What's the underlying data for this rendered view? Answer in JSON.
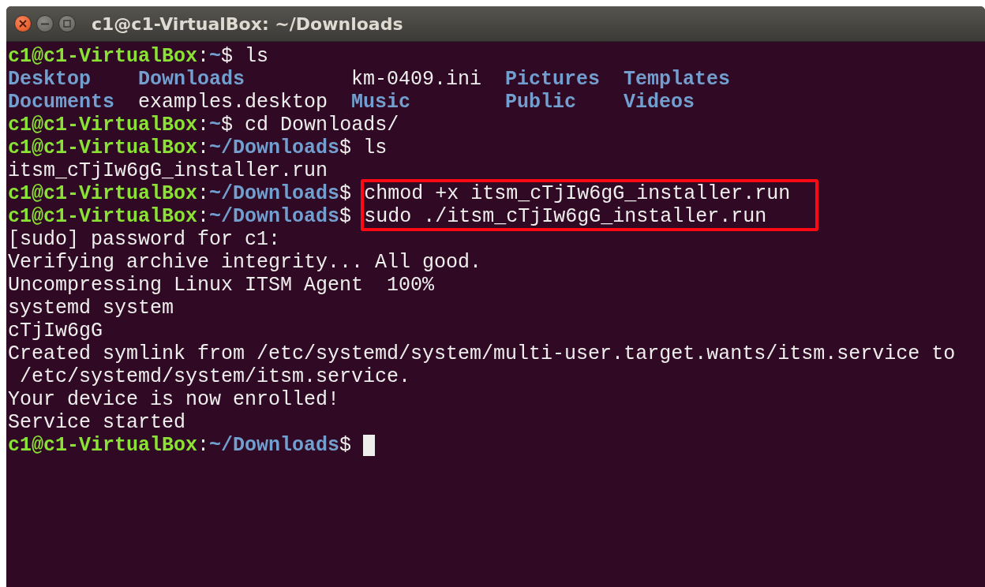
{
  "window": {
    "title": "c1@c1-VirtualBox: ~/Downloads"
  },
  "terminal": {
    "lines": [
      {
        "kind": "prompt",
        "user": "c1@c1-VirtualBox",
        "separator": ":",
        "path": "~",
        "symbol": "$",
        "command": "ls"
      },
      {
        "kind": "listing",
        "items": [
          {
            "name": "Desktop",
            "kind": "dir"
          },
          {
            "name": "Downloads",
            "kind": "dir"
          },
          {
            "name": "km-0409.ini",
            "kind": "file"
          },
          {
            "name": "Pictures",
            "kind": "dir"
          },
          {
            "name": "Templates",
            "kind": "dir"
          },
          {
            "name": "Documents",
            "kind": "dir"
          },
          {
            "name": "examples.desktop",
            "kind": "file"
          },
          {
            "name": "Music",
            "kind": "dir"
          },
          {
            "name": "Public",
            "kind": "dir"
          },
          {
            "name": "Videos",
            "kind": "dir"
          }
        ]
      },
      {
        "kind": "prompt",
        "user": "c1@c1-VirtualBox",
        "separator": ":",
        "path": "~",
        "symbol": "$",
        "command": "cd Downloads/"
      },
      {
        "kind": "prompt",
        "user": "c1@c1-VirtualBox",
        "separator": ":",
        "path": "~/Downloads",
        "symbol": "$",
        "command": "ls"
      },
      {
        "kind": "output",
        "text": "itsm_cTjIw6gG_installer.run"
      },
      {
        "kind": "highlight",
        "lines": [
          {
            "user": "c1@c1-VirtualBox",
            "separator": ":",
            "path": "~/Downloads",
            "symbol": "$",
            "command": "chmod +x itsm_cTjIw6gG_installer.run"
          },
          {
            "user": "c1@c1-VirtualBox",
            "separator": ":",
            "path": "~/Downloads",
            "symbol": "$",
            "command": "sudo ./itsm_cTjIw6gG_installer.run"
          }
        ]
      },
      {
        "kind": "output",
        "text": "[sudo] password for c1:"
      },
      {
        "kind": "output",
        "text": "Verifying archive integrity... All good."
      },
      {
        "kind": "output",
        "text": "Uncompressing Linux ITSM Agent  100%"
      },
      {
        "kind": "output",
        "text": "systemd system"
      },
      {
        "kind": "output",
        "text": "cTjIw6gG"
      },
      {
        "kind": "output",
        "text": "Created symlink from /etc/systemd/system/multi-user.target.wants/itsm.service to"
      },
      {
        "kind": "output",
        "text": " /etc/systemd/system/itsm.service."
      },
      {
        "kind": "output",
        "text": "Your device is now enrolled!"
      },
      {
        "kind": "output",
        "text": "Service started"
      },
      {
        "kind": "prompt",
        "user": "c1@c1-VirtualBox",
        "separator": ":",
        "path": "~/Downloads",
        "symbol": "$",
        "cursor": true
      }
    ]
  }
}
